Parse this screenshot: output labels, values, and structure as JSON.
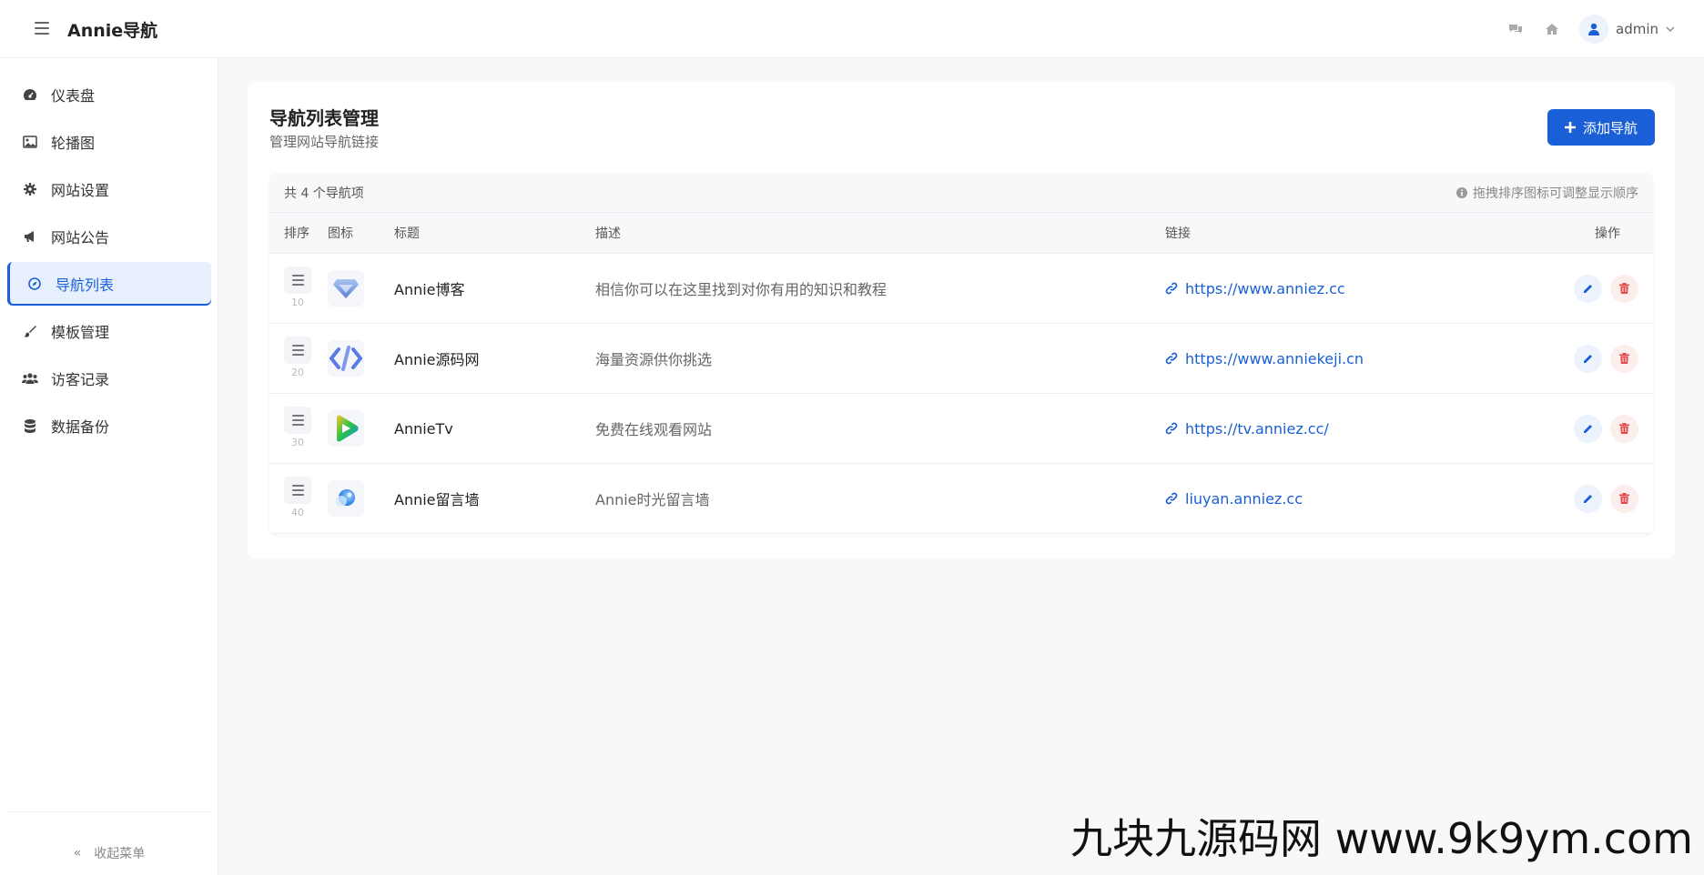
{
  "header": {
    "brand": "Annie导航",
    "user_name": "admin"
  },
  "sidebar": {
    "items": [
      {
        "label": "仪表盘",
        "icon": "dashboard-icon"
      },
      {
        "label": "轮播图",
        "icon": "image-icon"
      },
      {
        "label": "网站设置",
        "icon": "gear-icon"
      },
      {
        "label": "网站公告",
        "icon": "megaphone-icon"
      },
      {
        "label": "导航列表",
        "icon": "compass-icon",
        "active": true
      },
      {
        "label": "模板管理",
        "icon": "brush-icon"
      },
      {
        "label": "访客记录",
        "icon": "users-icon"
      },
      {
        "label": "数据备份",
        "icon": "database-icon"
      }
    ],
    "collapse_label": "收起菜单"
  },
  "main": {
    "title": "导航列表管理",
    "subtitle": "管理网站导航链接",
    "add_button": "添加导航",
    "count_text": "共 4 个导航项",
    "hint": "拖拽排序图标可调整显示顺序",
    "columns": {
      "order": "排序",
      "icon": "图标",
      "title": "标题",
      "desc": "描述",
      "link": "链接",
      "ops": "操作"
    },
    "rows": [
      {
        "order": "10",
        "title": "Annie博客",
        "desc": "相信你可以在这里找到对你有用的知识和教程",
        "link": "https://www.anniez.cc",
        "icon": "diamond-icon"
      },
      {
        "order": "20",
        "title": "Annie源码网",
        "desc": "海量资源供你挑选",
        "link": "https://www.anniekeji.cn",
        "icon": "code-icon"
      },
      {
        "order": "30",
        "title": "AnnieTv",
        "desc": "免费在线观看网站",
        "link": "https://tv.anniez.cc/",
        "icon": "play-icon"
      },
      {
        "order": "40",
        "title": "Annie留言墙",
        "desc": "Annie时光留言墙",
        "link": "liuyan.anniez.cc",
        "icon": "bubble-icon"
      }
    ]
  },
  "watermark": "九块九源码网 www.9k9ym.com",
  "colors": {
    "accent": "#1a5fd6",
    "danger": "#e24c4c"
  }
}
